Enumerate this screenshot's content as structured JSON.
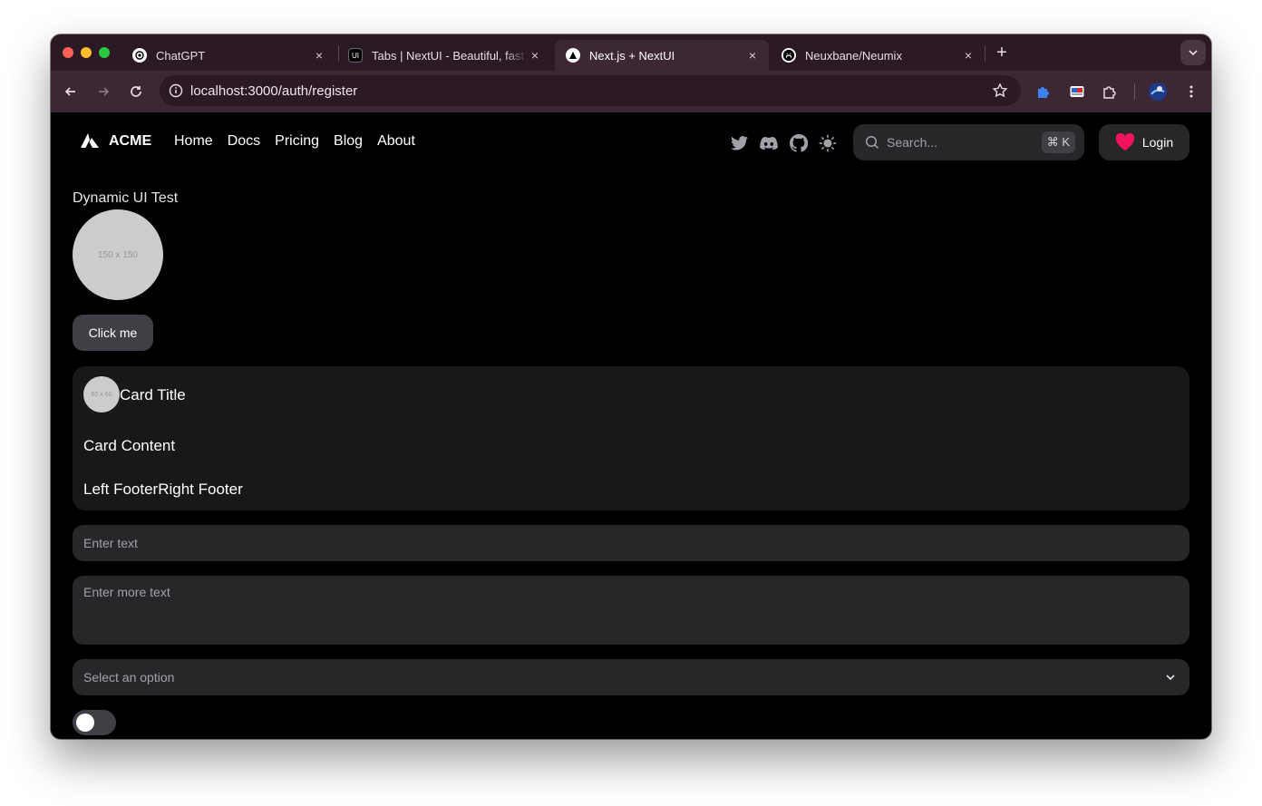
{
  "browser": {
    "tabs": [
      {
        "title": "ChatGPT",
        "icon": "chatgpt-icon",
        "active": false
      },
      {
        "title": "Tabs | NextUI - Beautiful, fast",
        "icon": "nextui-icon",
        "active": false
      },
      {
        "title": "Next.js + NextUI",
        "icon": "nextjs-icon",
        "active": true
      },
      {
        "title": "Neuxbane/Neumix",
        "icon": "github-icon",
        "active": false
      }
    ],
    "close_glyph": "×",
    "new_tab_glyph": "+",
    "address": "localhost:3000/auth/register"
  },
  "navbar": {
    "brand": "ACME",
    "links": [
      "Home",
      "Docs",
      "Pricing",
      "Blog",
      "About"
    ],
    "search_placeholder": "Search...",
    "search_shortcut": "⌘ K",
    "login_label": "Login",
    "login_heart_color": "#f31260"
  },
  "main": {
    "title": "Dynamic UI Test",
    "avatar_label": "150 x 150",
    "button_label": "Click me",
    "card": {
      "avatar_label": "60 x 60",
      "title": "Card Title",
      "content": "Card Content",
      "footer_left": "Left Footer",
      "footer_right": "Right Footer"
    },
    "input_placeholder": "Enter text",
    "textarea_placeholder": "Enter more text",
    "select_placeholder": "Select an option",
    "toggle_on": false
  }
}
